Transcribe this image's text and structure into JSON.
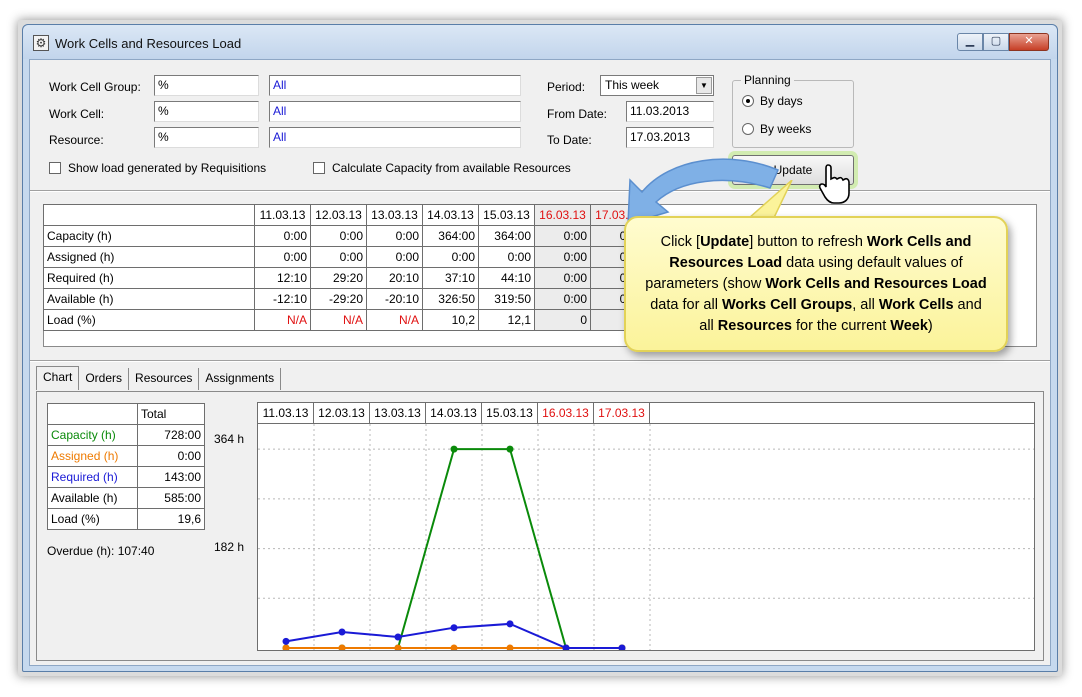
{
  "window": {
    "title": "Work Cells and Resources Load"
  },
  "filters": {
    "work_cell_group": {
      "label": "Work Cell Group:",
      "code": "%",
      "name": "All"
    },
    "work_cell": {
      "label": "Work Cell:",
      "code": "%",
      "name": "All"
    },
    "resource": {
      "label": "Resource:",
      "code": "%",
      "name": "All"
    },
    "period": {
      "label": "Period:",
      "value": "This week"
    },
    "from_date": {
      "label": "From Date:",
      "value": "11.03.2013"
    },
    "to_date": {
      "label": "To Date:",
      "value": "17.03.2013"
    },
    "planning": {
      "label": "Planning",
      "by_days": "By days",
      "by_weeks": "By weeks",
      "selected": "by_days"
    },
    "show_requisitions": "Show load generated by Requisitions",
    "calc_capacity": "Calculate Capacity from available Resources",
    "update_label": "Update"
  },
  "load_table": {
    "dates": [
      "11.03.13",
      "12.03.13",
      "13.03.13",
      "14.03.13",
      "15.03.13",
      "16.03.13",
      "17.03.13"
    ],
    "weekend_from_index": 5,
    "rows": [
      {
        "label": "Capacity (h)",
        "values": [
          "0:00",
          "0:00",
          "0:00",
          "364:00",
          "364:00",
          "0:00",
          "0:00"
        ]
      },
      {
        "label": "Assigned (h)",
        "values": [
          "0:00",
          "0:00",
          "0:00",
          "0:00",
          "0:00",
          "0:00",
          "0:00"
        ]
      },
      {
        "label": "Required (h)",
        "values": [
          "12:10",
          "29:20",
          "20:10",
          "37:10",
          "44:10",
          "0:00",
          "0:00"
        ]
      },
      {
        "label": "Available (h)",
        "values": [
          "-12:10",
          "-29:20",
          "-20:10",
          "326:50",
          "319:50",
          "0:00",
          "0:00"
        ]
      },
      {
        "label": "Load (%)",
        "values": [
          "N/A",
          "N/A",
          "N/A",
          "10,2",
          "12,1",
          "0",
          "0"
        ]
      }
    ]
  },
  "tabs": [
    "Chart",
    "Orders",
    "Resources",
    "Assignments"
  ],
  "summary": {
    "header": "Total",
    "rows": [
      {
        "label": "Capacity (h)",
        "value": "728:00"
      },
      {
        "label": "Assigned (h)",
        "value": "0:00"
      },
      {
        "label": "Required (h)",
        "value": "143:00"
      },
      {
        "label": "Available (h)",
        "value": "585:00"
      },
      {
        "label": "Load (%)",
        "value": "19,6"
      }
    ],
    "overdue": "Overdue (h): 107:40"
  },
  "colors": {
    "capacity": "#0a8a0a",
    "assigned": "#ee7a00",
    "required": "#1a1ad6",
    "weekend": "#e01010"
  },
  "chart_data": {
    "type": "line",
    "categories": [
      "11.03.13",
      "12.03.13",
      "13.03.13",
      "14.03.13",
      "15.03.13",
      "16.03.13",
      "17.03.13"
    ],
    "y_tick_labels": [
      "364 h",
      "182 h"
    ],
    "y_ticks": [
      364,
      182
    ],
    "ylim": [
      0,
      410
    ],
    "grid": true,
    "series": [
      {
        "name": "Capacity (h)",
        "values": [
          0,
          0,
          0,
          364,
          364,
          0,
          0
        ]
      },
      {
        "name": "Assigned (h)",
        "values": [
          0,
          0,
          0,
          0,
          0,
          0,
          0
        ]
      },
      {
        "name": "Required (h)",
        "values": [
          12.17,
          29.33,
          20.17,
          37.17,
          44.17,
          0,
          0
        ]
      }
    ]
  },
  "callout": {
    "p1": "Click [",
    "b1": "Update",
    "p2": "] button to refresh ",
    "b2": "Work Cells and Resources Load",
    "p3": " data using default values of parameters (show ",
    "b3": "Work Cells and Resources Load",
    "p4": " data for all ",
    "b4": "Works Cell Groups",
    "p5": ", all ",
    "b5": "Work Cells",
    "p6": " and all ",
    "b6": "Resources",
    "p7": " for the current ",
    "b7": "Week",
    "p8": ")"
  }
}
